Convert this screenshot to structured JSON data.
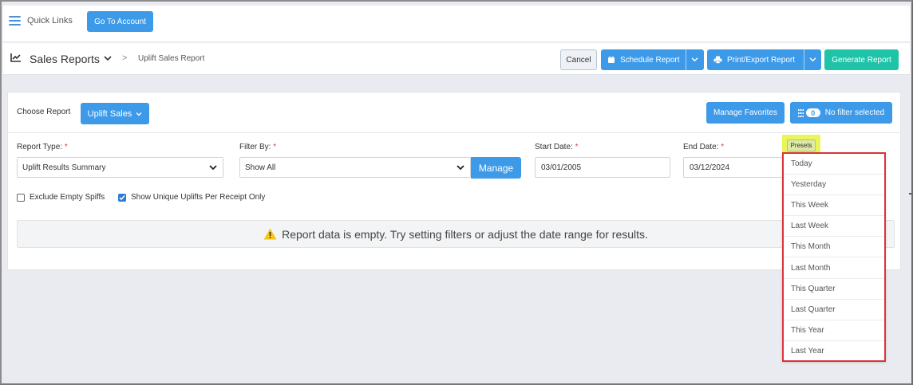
{
  "topbar": {
    "quick_links": "Quick Links",
    "go_to_account": "Go To Account"
  },
  "header": {
    "title": "Sales Reports",
    "breadcrumb": "Uplift Sales Report",
    "cancel": "Cancel",
    "schedule_report": "Schedule Report",
    "print_export": "Print/Export Report",
    "generate_report": "Generate Report"
  },
  "card": {
    "choose_report_label": "Choose Report",
    "choose_report_value": "Uplift Sales",
    "manage_favorites": "Manage Favorites",
    "filter_count": "0",
    "no_filter": "No filter selected",
    "report_type_label": "Report Type:",
    "report_type_value": "Uplift Results Summary",
    "filter_by_label": "Filter By:",
    "filter_by_value": "Show All",
    "manage": "Manage",
    "start_date_label": "Start Date:",
    "start_date_value": "03/01/2005",
    "end_date_label": "End Date:",
    "end_date_value": "03/12/2024",
    "required_mark": "*",
    "exclude_empty_spiffs": "Exclude Empty Spiffs",
    "show_unique_uplifts": "Show Unique Uplifts Per Receipt Only",
    "empty_message": "Report data is empty. Try setting filters or adjust the date range for results."
  },
  "presets": {
    "label": "Presets",
    "items": [
      "Today",
      "Yesterday",
      "This Week",
      "Last Week",
      "This Month",
      "Last Month",
      "This Quarter",
      "Last Quarter",
      "This Year",
      "Last Year"
    ]
  },
  "colors": {
    "primary": "#3d9ae8",
    "teal": "#1fc3a8",
    "highlight": "#eaf55a",
    "menu_border": "#d9343a"
  }
}
